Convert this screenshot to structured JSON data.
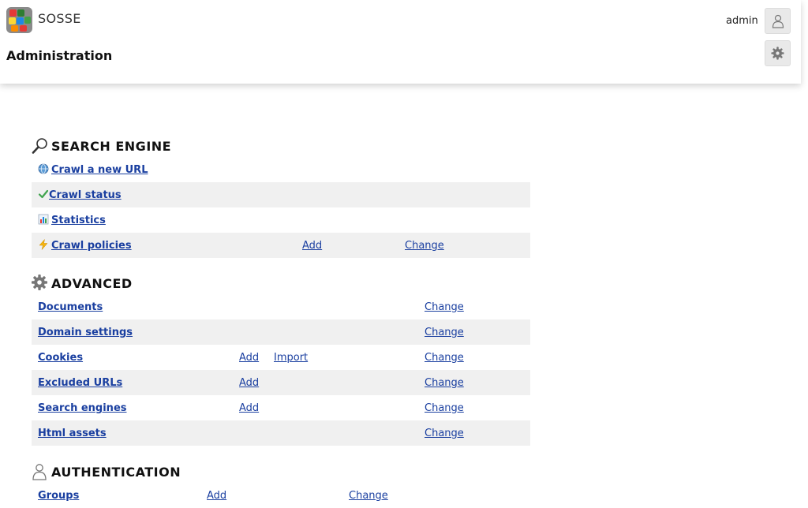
{
  "header": {
    "brand": "SOSSE",
    "title": "Administration",
    "user": "admin",
    "icons": {
      "logo": "sosse-logo",
      "user": "user-icon",
      "settings": "gear-icon"
    }
  },
  "sections": {
    "search_engine": {
      "title": "SEARCH ENGINE",
      "icon": "magnifier-icon",
      "rows": [
        {
          "label": "Crawl a new URL",
          "icon": "globe-icon"
        },
        {
          "label": "Crawl status",
          "icon": "check-icon"
        },
        {
          "label": "Statistics",
          "icon": "chart-icon"
        },
        {
          "label": "Crawl policies",
          "icon": "lightning-icon",
          "add": "Add",
          "change": "Change"
        }
      ]
    },
    "advanced": {
      "title": "ADVANCED",
      "icon": "gear-icon",
      "rows": [
        {
          "label": "Documents",
          "change": "Change"
        },
        {
          "label": "Domain settings",
          "change": "Change"
        },
        {
          "label": "Cookies",
          "add": "Add",
          "import": "Import",
          "change": "Change"
        },
        {
          "label": "Excluded URLs",
          "add": "Add",
          "change": "Change"
        },
        {
          "label": "Search engines",
          "add": "Add",
          "change": "Change"
        },
        {
          "label": "Html assets",
          "change": "Change"
        }
      ]
    },
    "authentication": {
      "title": "AUTHENTICATION",
      "icon": "user-icon",
      "rows": [
        {
          "label": "Groups",
          "add": "Add",
          "change": "Change"
        }
      ]
    }
  },
  "colors": {
    "link": "#1a3fa0",
    "row_shade": "#f0f0f0"
  }
}
